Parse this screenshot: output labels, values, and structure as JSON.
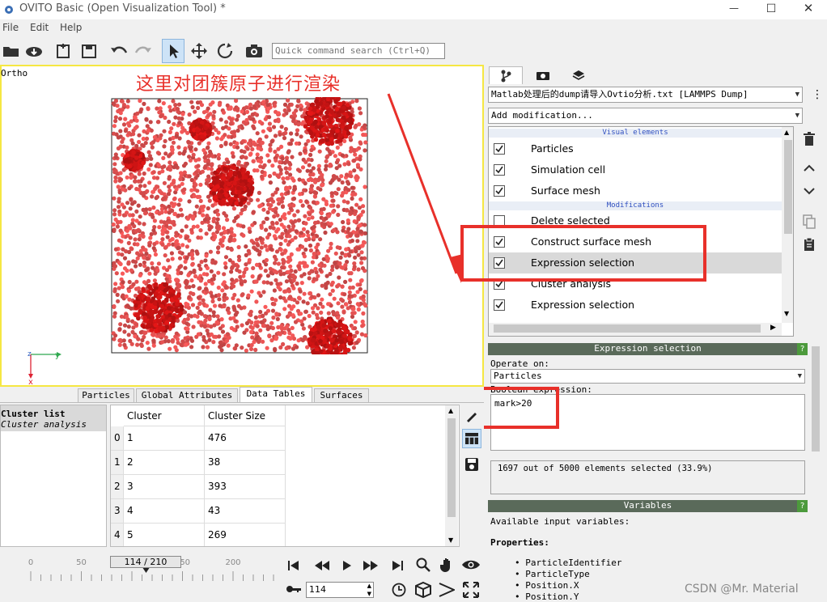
{
  "window": {
    "title": "OVITO Basic (Open Visualization Tool) *"
  },
  "menu": [
    "File",
    "Edit",
    "Help"
  ],
  "toolbar": {
    "search_placeholder": "Quick command search (Ctrl+Q)"
  },
  "viewport": {
    "label": "Ortho",
    "annotation": "这里对团簇原子进行渲染",
    "axis_x": "y",
    "axis_y": "x",
    "axis_z": "z"
  },
  "pipeline": {
    "source": "Matlab处理后的dump请导入Ovtio分析.txt [LAMMPS Dump]",
    "add_modification": "Add modification...",
    "visual_header": "Visual elements",
    "modifications_header": "Modifications",
    "visual_items": [
      "Particles",
      "Simulation cell",
      "Surface mesh"
    ],
    "modification_items": [
      "Delete selected",
      "Construct surface mesh",
      "Expression selection",
      "Cluster analysis",
      "Expression selection"
    ],
    "checked": [
      true,
      true,
      true,
      false,
      true,
      true,
      true,
      true
    ]
  },
  "expression_panel": {
    "title": "Expression selection",
    "help": "?",
    "operate_on_label": "Operate on:",
    "operate_on_value": "Particles",
    "boolean_label": "Boolean expression:",
    "expression": "mark>20",
    "status": "1697 out of 5000 elements selected (33.9%)"
  },
  "variables_panel": {
    "title": "Variables",
    "help": "?",
    "available": "Available input variables:",
    "properties_label": "Properties:",
    "properties": [
      "ParticleIdentifier",
      "ParticleType",
      "Position.X",
      "Position.Y"
    ]
  },
  "bottom_tabs": [
    "Particles",
    "Global Attributes",
    "Data Tables",
    "Surfaces"
  ],
  "cluster_list": {
    "title": "Cluster list",
    "subtitle": "Cluster analysis"
  },
  "table": {
    "columns": [
      "Cluster Identifier",
      "Cluster Size"
    ],
    "rows": [
      [
        "0",
        "1",
        "476"
      ],
      [
        "1",
        "2",
        "38"
      ],
      [
        "2",
        "3",
        "393"
      ],
      [
        "3",
        "4",
        "43"
      ],
      [
        "4",
        "5",
        "269"
      ]
    ]
  },
  "timeline": {
    "ticks": [
      "0",
      "50",
      "100",
      "150",
      "200"
    ],
    "frame_display": "114 / 210",
    "frame_input": "114"
  },
  "watermark": "CSDN @Mr. Material",
  "colors": {
    "highlight": "#e8302a",
    "viewport_border": "#f5e742",
    "particle": "#e05a5a"
  }
}
